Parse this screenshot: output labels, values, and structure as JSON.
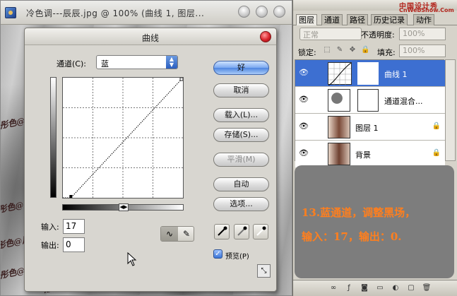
{
  "document": {
    "title": "冷色调---辰辰.jpg @ 100% (曲线 1, 图层...",
    "watermark": "彤色@辰辰"
  },
  "curves_dialog": {
    "title": "曲线",
    "channel_label": "通道(C):",
    "channel_value": "蓝",
    "input_label": "输入:",
    "input_value": "17",
    "output_label": "输出:",
    "output_value": "0",
    "buttons": {
      "ok": "好",
      "cancel": "取消",
      "load": "载入(L)...",
      "save": "存储(S)...",
      "smooth": "平滑(M)",
      "auto": "自动",
      "options": "选项..."
    },
    "preview_checked": true,
    "preview_label": "预览(P)",
    "curve": {
      "input_range": [
        0,
        255
      ],
      "points": [
        [
          17,
          0
        ],
        [
          255,
          255
        ]
      ]
    }
  },
  "layers_panel": {
    "site_mark": "中国设计秀",
    "site_mark2": "CnWebShow.Com",
    "tabs": [
      "图层",
      "通道",
      "路径",
      "历史记录",
      "动作"
    ],
    "blend_mode": "正常",
    "opacity_label": "不透明度:",
    "opacity_value": "100%",
    "lock_label": "锁定:",
    "fill_label": "填充:",
    "fill_value": "100%",
    "layers": [
      {
        "name": "曲线 1",
        "selected": true,
        "type": "adjustment-curves",
        "locked": false
      },
      {
        "name": "通道混合...",
        "selected": false,
        "type": "adjustment-channel-mixer",
        "locked": false
      },
      {
        "name": "图层 1",
        "selected": false,
        "type": "image",
        "locked": true
      },
      {
        "name": "背景",
        "selected": false,
        "type": "image",
        "locked": true
      }
    ],
    "caption_line1": "13.蓝通道，调整黑场，",
    "caption_line2": "输入：17，输出：0."
  },
  "colors": {
    "accent_blue": "#3d6fd1",
    "caption_orange": "#ff7f1e",
    "close_red": "#d8232a"
  }
}
